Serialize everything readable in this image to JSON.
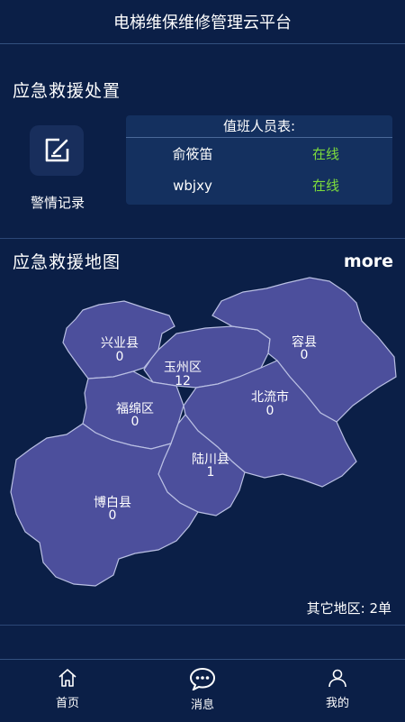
{
  "header": {
    "title": "电梯维保维修管理云平台"
  },
  "emergency": {
    "title": "应急救援处置",
    "alarm_label": "警情记录",
    "duty": {
      "title": "值班人员表:",
      "rows": [
        {
          "name": "俞筱笛",
          "status": "在线"
        },
        {
          "name": "wbjxy",
          "status": "在线"
        }
      ]
    }
  },
  "map_section": {
    "title": "应急救援地图",
    "more": "more",
    "regions": [
      {
        "name": "兴业县",
        "count": "0"
      },
      {
        "name": "玉州区",
        "count": "12"
      },
      {
        "name": "容县",
        "count": "0"
      },
      {
        "name": "福绵区",
        "count": "0"
      },
      {
        "name": "北流市",
        "count": "0"
      },
      {
        "name": "陆川县",
        "count": "1"
      },
      {
        "name": "博白县",
        "count": "0"
      }
    ],
    "other_label": "其它地区:",
    "other_value": "2单"
  },
  "tabs": [
    {
      "label": "首页"
    },
    {
      "label": "消息"
    },
    {
      "label": "我的"
    }
  ],
  "colors": {
    "background": "#0b1f47",
    "map_fill": "#4c4f9c",
    "online": "#7ddc3c"
  }
}
